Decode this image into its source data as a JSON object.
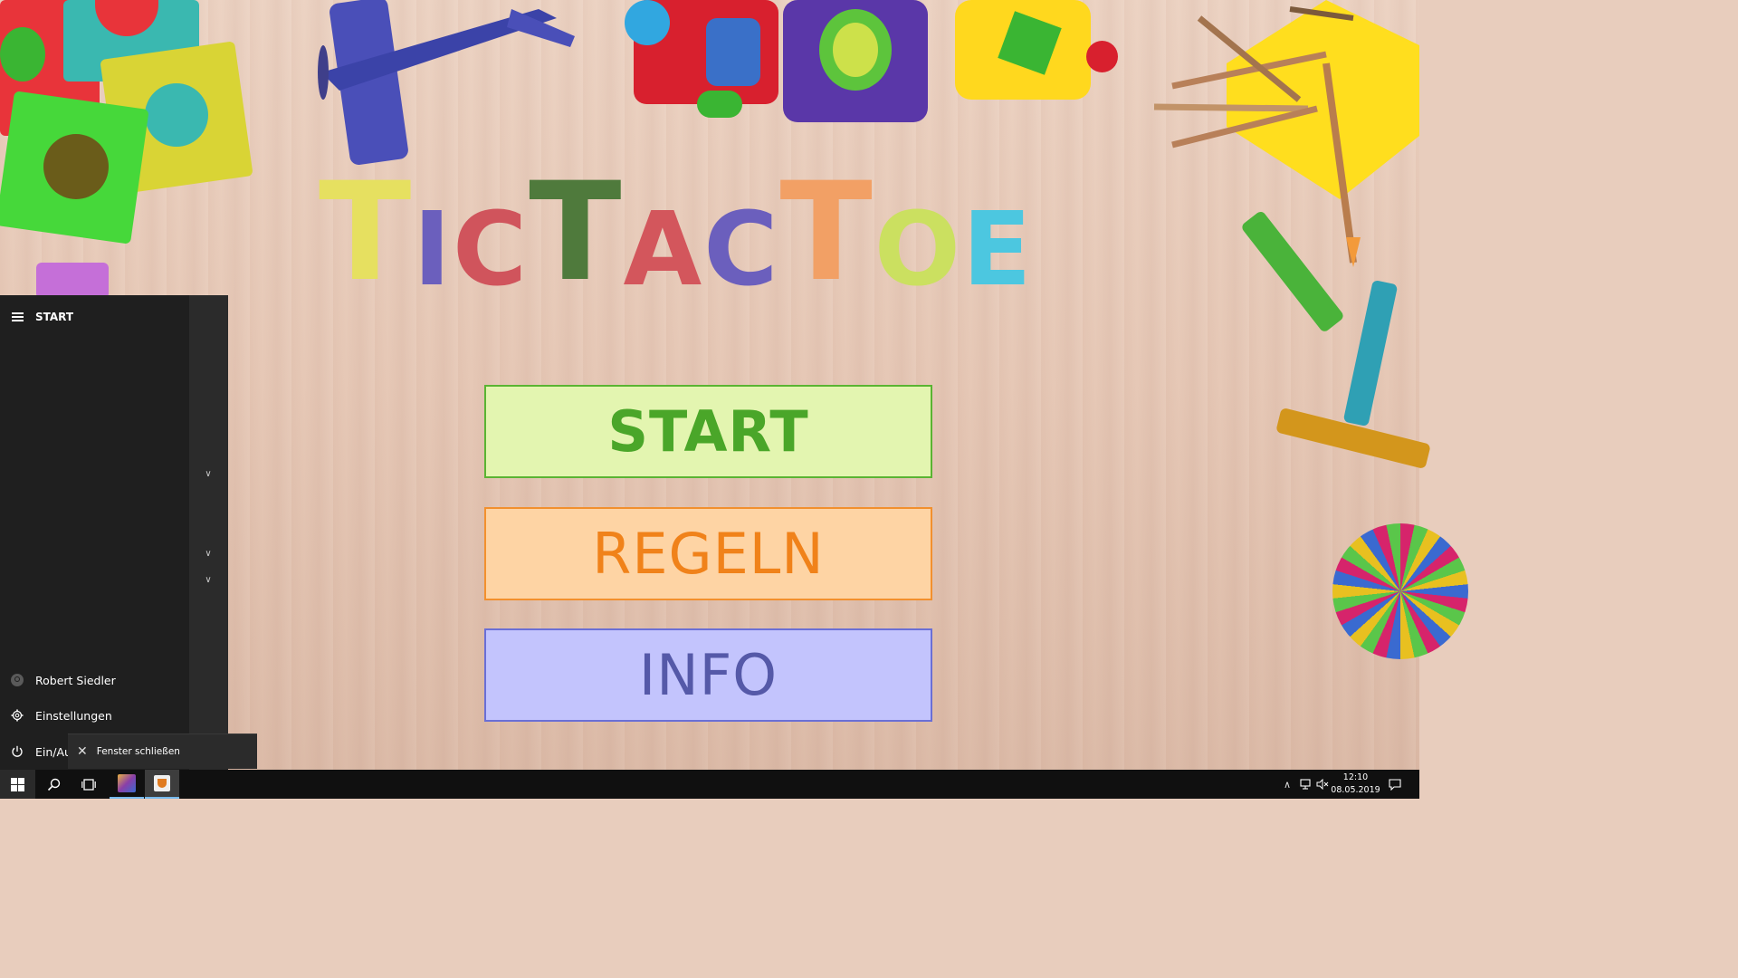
{
  "game": {
    "title_letters": [
      "T",
      "ic",
      "T",
      "ac",
      "T",
      "oe"
    ],
    "title_colors": {
      "T1": "#e6e060",
      "i": "#6b5fbd",
      "c1": "#d0545c",
      "T2": "#4f7a3c",
      "a": "#d3565c",
      "c2": "#6b5fbd",
      "T3": "#f2a065",
      "o": "#cbe060",
      "e": "#4cc7e0"
    },
    "buttons": {
      "start": "START",
      "regeln": "REGELN",
      "info": "INFO"
    }
  },
  "start_menu": {
    "header": "START",
    "user": "Robert Siedler",
    "settings": "Einstellungen",
    "power": "Ein/Au",
    "tooltip": "Fenster schließen"
  },
  "taskbar": {
    "time": "12:10",
    "date": "08.05.2019"
  },
  "colors": {
    "start_bg": "#e3f5b0",
    "regeln_bg": "#fed4a4",
    "info_bg": "#c3c4fd",
    "taskbar": "#101010",
    "startmenu": "#1f1f1f"
  }
}
